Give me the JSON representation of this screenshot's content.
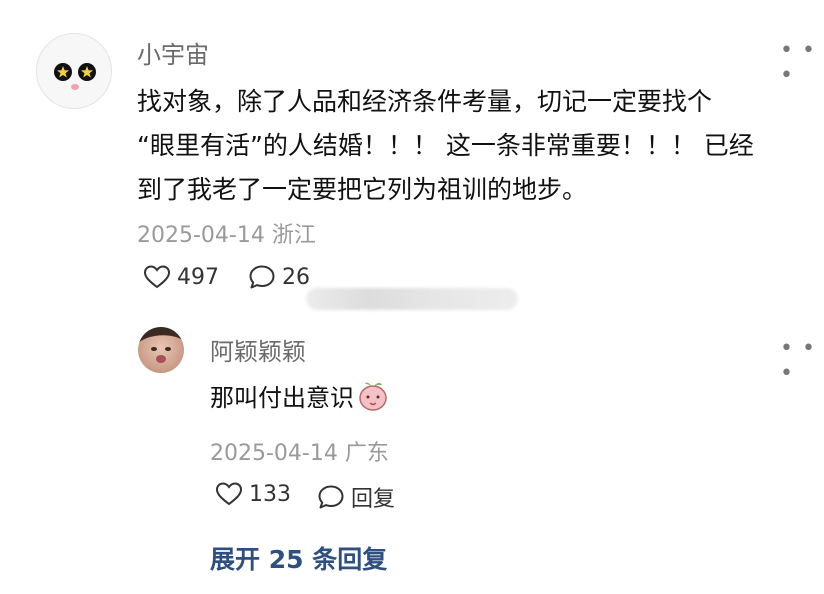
{
  "post": {
    "username": "小宇宙",
    "text_lines": [
      "找对象，除了人品和经济条件考量，切记一定要找个",
      "“眼里有活”的人结婚！！！ 这一条非常重要！！！ 已经",
      "到了我老了一定要把它列为祖训的地步。"
    ],
    "date": "2025-04-14",
    "location": "浙江",
    "likes": "497",
    "comments": "26"
  },
  "reply": {
    "username": "阿颖颖颖",
    "text": "那叫付出意识",
    "emoji": "peach-sticker",
    "date": "2025-04-14",
    "location": "广东",
    "likes": "133",
    "reply_label": "回复"
  },
  "expand_label": "展开 25 条回复",
  "colors": {
    "link": "#2f4f7f",
    "meta": "#9a9a9a",
    "username": "#6b6b6b"
  }
}
